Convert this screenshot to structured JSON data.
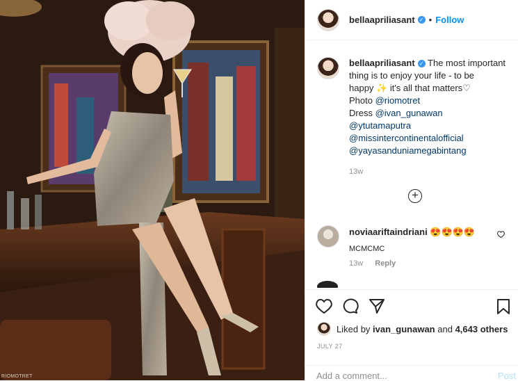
{
  "post": {
    "username": "bellaapriliasant",
    "follow_label": "Follow",
    "separator": "•",
    "watermark": "RIOMOTRET"
  },
  "caption": {
    "username": "bellaapriliasant",
    "lines": [
      "The most important",
      "thing is to enjoy your life - to be",
      "happy ✨ it's all that matters♡"
    ],
    "photo_prefix": "Photo",
    "photo_credit": "@riomotret",
    "dress_prefix": "Dress",
    "tags": [
      "@ivan_gunawan",
      "@ytutamaputra",
      "@missintercontinentalofficial",
      "@yayasanduniamegabintang"
    ],
    "time": "13w"
  },
  "load_more_symbol": "+",
  "comment": {
    "username": "noviaariftaindriani",
    "emojis": "😍😍😍😍",
    "text": "MCMCMC",
    "time": "13w",
    "reply_label": "Reply"
  },
  "likes": {
    "prefix": "Liked by",
    "user": "ivan_gunawan",
    "middle": "and",
    "count": "4,643 others"
  },
  "date": "JULY 27",
  "add_comment": {
    "placeholder": "Add a comment...",
    "post_label": "Post"
  },
  "colors": {
    "link": "#00376b",
    "follow": "#0095f6",
    "verified": "#3897f0"
  },
  "icons": [
    "heart-icon",
    "comment-icon",
    "share-icon",
    "bookmark-icon",
    "plus-circle-icon",
    "verified-icon"
  ]
}
